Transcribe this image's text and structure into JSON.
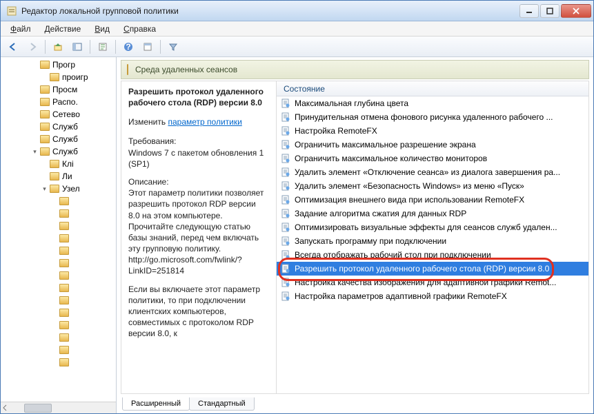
{
  "window": {
    "title": "Редактор локальной групповой политики"
  },
  "menu": {
    "file": "Файл",
    "action": "Действие",
    "view": "Вид",
    "help": "Справка"
  },
  "tree": {
    "items": [
      {
        "label": "Прогр",
        "indent": 44
      },
      {
        "label": "проигр",
        "indent": 58
      },
      {
        "label": "Просм",
        "indent": 44
      },
      {
        "label": "Распо.",
        "indent": 44
      },
      {
        "label": "Сетево",
        "indent": 44
      },
      {
        "label": "Служб",
        "indent": 44
      },
      {
        "label": "Служб",
        "indent": 44
      },
      {
        "label": "Служб",
        "indent": 44,
        "expander": "▾"
      },
      {
        "label": "Клі",
        "indent": 58
      },
      {
        "label": "Ли",
        "indent": 58
      },
      {
        "label": "Узел",
        "indent": 58,
        "expander": "▾"
      },
      {
        "label": "",
        "indent": 72
      },
      {
        "label": "",
        "indent": 72
      },
      {
        "label": "",
        "indent": 72
      },
      {
        "label": "",
        "indent": 72
      },
      {
        "label": "",
        "indent": 72
      },
      {
        "label": "",
        "indent": 72
      },
      {
        "label": "",
        "indent": 72
      },
      {
        "label": "",
        "indent": 72
      },
      {
        "label": "",
        "indent": 72
      },
      {
        "label": "",
        "indent": 72
      },
      {
        "label": "",
        "indent": 72
      },
      {
        "label": "",
        "indent": 72
      },
      {
        "label": "",
        "indent": 72
      },
      {
        "label": "",
        "indent": 72
      }
    ]
  },
  "pane": {
    "header": "Среда удаленных сеансов"
  },
  "desc": {
    "title": "Разрешить протокол удаленного рабочего стола (RDP) версии 8.0",
    "edit_label": "Изменить",
    "edit_link": "параметр политики",
    "req_label": "Требования:",
    "req_text": "Windows 7 с пакетом обновления 1 (SP1)",
    "desc_label": "Описание:",
    "desc_text": "Этот параметр политики позволяет разрешить протокол RDP версии 8.0 на этом компьютере. Прочитайте следующую статью базы знаний, перед чем включать эту групповую политику. http://go.microsoft.com/fwlink/?LinkID=251814",
    "desc_text2": "Если вы включаете этот параметр политики, то при подключении клиентских компьютеров, совместимых с протоколом RDP версии 8.0, к"
  },
  "list": {
    "header": "Состояние",
    "items": [
      "Максимальная глубина цвета",
      "Принудительная отмена фонового рисунка удаленного рабочего ...",
      "Настройка RemoteFX",
      "Ограничить максимальное разрешение экрана",
      "Ограничить максимальное количество мониторов",
      "Удалить элемент «Отключение сеанса» из диалога завершения ра...",
      "Удалить элемент «Безопасность Windows» из меню «Пуск»",
      "Оптимизация внешнего вида при использовании RemoteFX",
      "Задание алгоритма сжатия для данных RDP",
      "Оптимизировать визуальные эффекты для сеансов служб удален...",
      "Запускать программу при подключении",
      "Всегда отображать рабочий стол при подключении",
      "Разрешить протокол удаленного рабочего стола (RDP) версии 8.0",
      "Настройка качества изображения для адаптивной графики Remot...",
      "Настройка параметров адаптивной графики RemoteFX"
    ],
    "selected_index": 12
  },
  "tabs": {
    "extended": "Расширенный",
    "standard": "Стандартный"
  }
}
